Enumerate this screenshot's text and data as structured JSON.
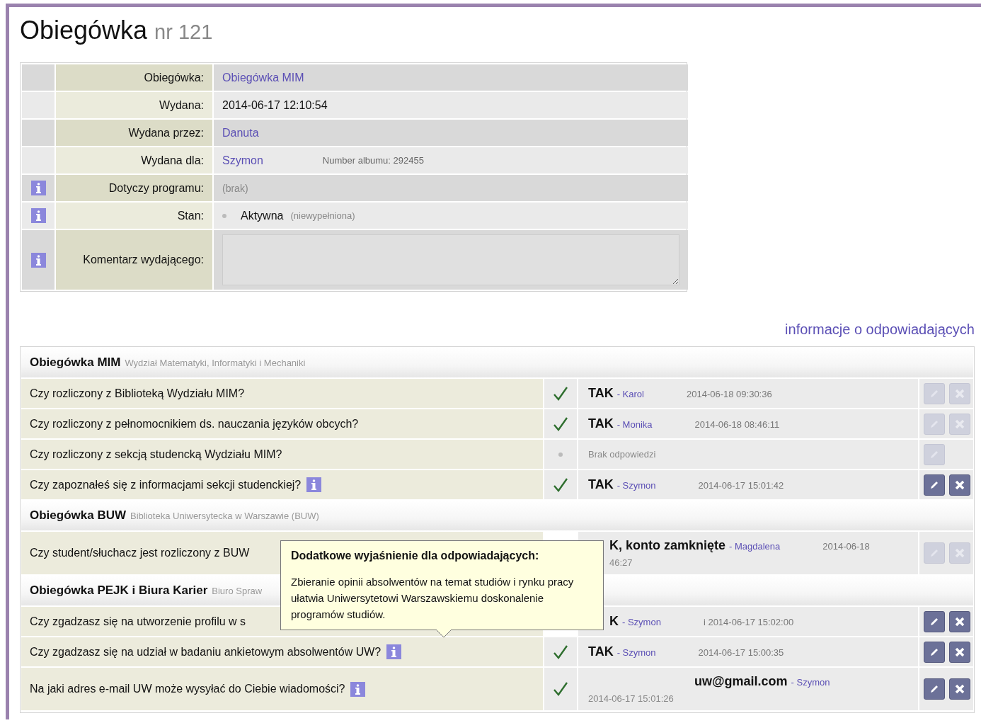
{
  "title": {
    "main": "Obiegówka",
    "sub": "nr 121"
  },
  "info_rows": [
    {
      "label": "Obiegówka:",
      "info": false,
      "kind": "link",
      "value": "Obiegówka MIM"
    },
    {
      "label": "Wydana:",
      "info": false,
      "kind": "text",
      "value": "2014-06-17 12:10:54"
    },
    {
      "label": "Wydana przez:",
      "info": false,
      "kind": "link",
      "value": "Danuta"
    },
    {
      "label": "Wydana dla:",
      "info": false,
      "kind": "link",
      "value": "Szymon",
      "note": "Number albumu: 292455"
    },
    {
      "label": "Dotyczy programu:",
      "info": true,
      "kind": "muted",
      "value": "(brak)"
    },
    {
      "label": "Stan:",
      "info": true,
      "kind": "status",
      "value": "Aktywna",
      "note": "(niewypełniona)"
    },
    {
      "label": "Komentarz wydającego:",
      "info": true,
      "kind": "textarea",
      "value": ""
    }
  ],
  "responders_link": "informacje o odpowiadających",
  "groups": [
    {
      "title": "Obiegówka MIM",
      "subtitle": "Wydział Matematyki, Informatyki i Mechaniki",
      "rows": [
        {
          "question": "Czy rozliczony z Biblioteką Wydziału MIM?",
          "info": false,
          "checked": true,
          "answer": {
            "kind": "inline",
            "value": "TAK",
            "by": "- Karol",
            "time": "2014-06-18 09:30:36"
          },
          "edit_enabled": false,
          "delete_enabled": false
        },
        {
          "question": "Czy rozliczony z pełnomocnikiem ds. nauczania języków obcych?",
          "info": false,
          "checked": true,
          "answer": {
            "kind": "inline",
            "value": "TAK",
            "by": "- Monika",
            "time": "2014-06-18 08:46:11"
          },
          "edit_enabled": false,
          "delete_enabled": false
        },
        {
          "question": "Czy rozliczony z sekcją studencką Wydziału MIM?",
          "info": false,
          "checked": false,
          "answer": {
            "kind": "empty",
            "value": "Brak odpowiedzi"
          },
          "edit_enabled": false
        },
        {
          "question": "Czy zapoznałeś się z informacjami sekcji studenckiej?",
          "info": true,
          "checked": true,
          "answer": {
            "kind": "inline",
            "value": "TAK",
            "by": "- Szymon",
            "time": "2014-06-17 15:01:42"
          },
          "edit_enabled": true,
          "delete_enabled": true
        }
      ]
    },
    {
      "title": "Obiegówka BUW",
      "subtitle": "Biblioteka Uniwersytecka w Warszawie (BUW)",
      "rows": [
        {
          "question": "Czy student/słuchacz jest rozliczony z BUW",
          "info": false,
          "answer": {
            "kind": "split",
            "value": "K, konto zamknięte",
            "by": "- Magdalena",
            "time": "2014-06-18",
            "time_rest": "46:27"
          },
          "edit_enabled": false,
          "delete_enabled": false
        }
      ]
    },
    {
      "title": "Obiegówka PEJK i Biura Karier",
      "subtitle": "Biuro Spraw",
      "rows": [
        {
          "question": "Czy zgadzasz się na utworzenie profilu w s",
          "info": false,
          "answer": {
            "kind": "clipped",
            "value": "K",
            "by": "- Szymon",
            "time": "i 2014-06-17 15:02:00"
          },
          "edit_enabled": true,
          "delete_enabled": true
        },
        {
          "question": "Czy zgadzasz się na udział w badaniu ankietowym absolwentów UW?",
          "info": true,
          "checked": true,
          "answer": {
            "kind": "inline",
            "value": "TAK",
            "by": "- Szymon",
            "time": "2014-06-17 15:00:35"
          },
          "edit_enabled": true,
          "delete_enabled": true
        },
        {
          "question": "Na jaki adres e-mail UW może wysyłać do Ciebie wiadomości?",
          "info": true,
          "checked": true,
          "answer": {
            "kind": "wrapped",
            "value": "uw@gmail.com",
            "by": "- Szymon",
            "time": "2014-06-17 15:01:26"
          },
          "edit_enabled": true,
          "delete_enabled": true
        }
      ]
    }
  ],
  "tooltip": {
    "title": "Dodatkowe wyjaśnienie dla odpowiadających:",
    "text": "Zbieranie opinii absolwentów na temat studiów i rynku pracy ułatwia Uniwersytetowi Warszawskiemu doskonalenie programów studiów."
  }
}
